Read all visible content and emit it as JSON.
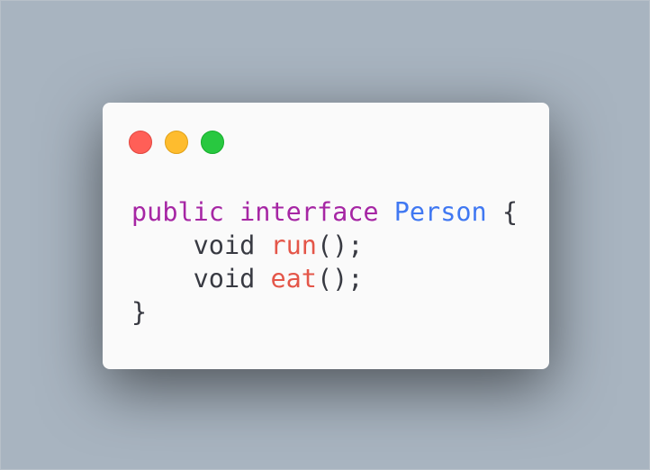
{
  "colors": {
    "background": "#a8b4c0",
    "card": "#fafafa",
    "keyword": "#a626a4",
    "class_name": "#4078f2",
    "function": "#e45649",
    "text": "#383a42"
  },
  "window_controls": {
    "close": "red-dot",
    "minimize": "yellow-dot",
    "maximize": "green-dot"
  },
  "code": {
    "line1": {
      "kw1": "public",
      "kw2": "interface",
      "class": "Person",
      "brace_open": "{"
    },
    "line2": {
      "type": "void",
      "name": "run",
      "suffix": "();"
    },
    "line3": {
      "type": "void",
      "name": "eat",
      "suffix": "();"
    },
    "line4": {
      "brace_close": "}"
    }
  }
}
